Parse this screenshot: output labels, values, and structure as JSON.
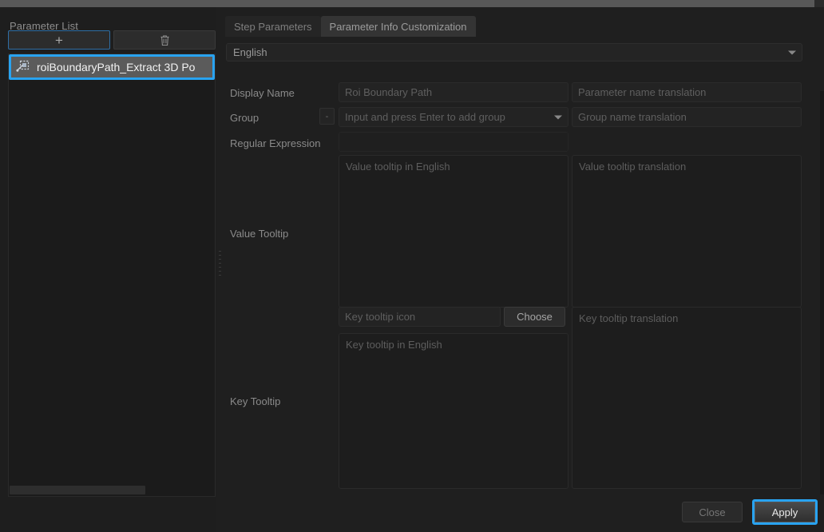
{
  "window": {
    "titlebar_color": "#585858",
    "accent_color": "#29a3f0"
  },
  "left_panel": {
    "title": "Parameter List",
    "toolbar": {
      "add_label": "+",
      "add_icon": "plus-icon",
      "delete_icon": "trash-icon"
    },
    "items": [
      {
        "icon": "marquee-select-icon",
        "label": "roiBoundaryPath_Extract 3D Po",
        "selected": true
      }
    ]
  },
  "right_panel": {
    "tabs": [
      {
        "label": "Step Parameters",
        "active": false
      },
      {
        "label": "Parameter Info Customization",
        "active": true
      }
    ],
    "language": {
      "value": "English",
      "arrow_icon": "chevron-down-icon"
    },
    "rows": {
      "display_name": {
        "label": "Display Name",
        "value": "Roi Boundary Path",
        "translation_placeholder": "Parameter name translation"
      },
      "group": {
        "label": "Group",
        "mini_button_label": "-",
        "placeholder": "Input and press Enter to add group",
        "arrow_icon": "chevron-down-icon",
        "translation_placeholder": "Group name translation"
      },
      "regular_expression": {
        "label": "Regular Expression",
        "value": ""
      },
      "value_tooltip": {
        "label": "Value Tooltip",
        "placeholder": "Value tooltip in English",
        "translation_placeholder": "Value tooltip translation"
      },
      "key_tooltip_icon": {
        "placeholder": "Key tooltip icon",
        "choose_label": "Choose",
        "translation_placeholder": "Key tooltip translation"
      },
      "key_tooltip": {
        "label": "Key Tooltip",
        "placeholder": "Key tooltip in English"
      }
    },
    "footer": {
      "close_label": "Close",
      "apply_label": "Apply",
      "apply_focused": true
    }
  }
}
